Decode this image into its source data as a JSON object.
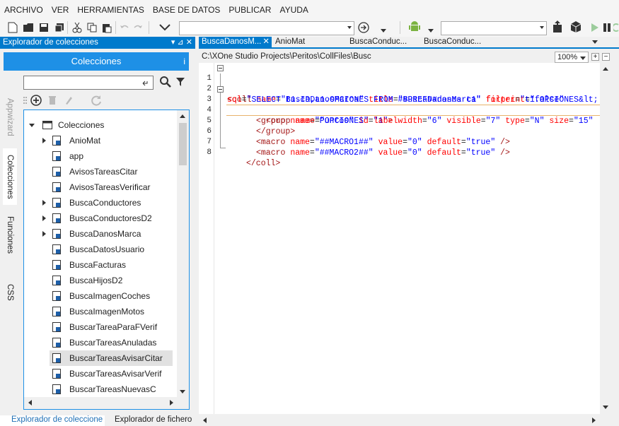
{
  "menu": [
    "ARCHIVO",
    "VER",
    "HERRAMIENTAS",
    "BASE DE DATOS",
    "PUBLICAR",
    "AYUDA"
  ],
  "left_panel": {
    "title": "Explorador de colecciones",
    "controls": "▾ ⊿ ✕",
    "header": "Colecciones",
    "header_info": "i",
    "side_tabs": [
      "Appwizard",
      "Colecciones",
      "Funciones",
      "CSS"
    ],
    "tree": {
      "root": "Colecciones",
      "items": [
        {
          "label": "AnioMat",
          "expandable": true
        },
        {
          "label": "app",
          "expandable": false
        },
        {
          "label": "AvisosTareasCitar",
          "expandable": false
        },
        {
          "label": "AvisosTareasVerificar",
          "expandable": false
        },
        {
          "label": "BuscaConductores",
          "expandable": true
        },
        {
          "label": "BuscaConductoresD2",
          "expandable": true
        },
        {
          "label": "BuscaDanosMarca",
          "expandable": true
        },
        {
          "label": "BuscaDatosUsuario",
          "expandable": false
        },
        {
          "label": "BuscaFacturas",
          "expandable": false
        },
        {
          "label": "BuscaHijosD2",
          "expandable": false
        },
        {
          "label": "BuscaImagenCoches",
          "expandable": false
        },
        {
          "label": "BuscaImagenMotos",
          "expandable": false
        },
        {
          "label": "BuscarTareaParaFVerif",
          "expandable": false
        },
        {
          "label": "BuscarTareasAnuladas",
          "expandable": false
        },
        {
          "label": "BuscarTareasAvisarCitar",
          "expandable": false,
          "selected": true
        },
        {
          "label": "BuscarTareasAvisarVerif",
          "expandable": false
        },
        {
          "label": "BuscarTareasNuevasC",
          "expandable": false
        }
      ]
    },
    "bottom_tabs": [
      "Explorador de coleccione",
      "Explorador de fichero"
    ]
  },
  "editor": {
    "tabs": [
      {
        "label": "BuscaDanosM...",
        "active": true,
        "close": "✕"
      },
      {
        "label": "AnioMat",
        "active": false
      },
      {
        "label": "BuscaConduc...",
        "active": false
      },
      {
        "label": "BuscaConduc...",
        "active": false
      }
    ],
    "path": "C:\\XOne Studio Projects\\Peritos\\CollFiles\\Busc",
    "zoom": "100%",
    "line_numbers": [
      "1",
      "2",
      "3",
      "4",
      "5",
      "6",
      "7",
      "8"
    ],
    "lines": [
      "<coll name=\"BuscaDanosMarca\" title=\"BuscaDanosMarca\" forprint=\"false\"",
      "sql=\"SELECT t1.ID,t1.OPCIONES FROM ##PREF##danos t1\" filter=\"t1.OPCIONES&lt;",
      "<group name=\"Puntos\" id=\"1\">",
      "<prop name=\"OPCIONES\" labelwidth=\"6\" visible=\"7\" type=\"N\" size=\"15\"",
      "</group>",
      "<macro name=\"##MACRO1##\" value=\"0\" default=\"true\" />",
      "<macro name=\"##MACRO2##\" value=\"0\" default=\"true\" />",
      "</coll>"
    ]
  },
  "colors": {
    "accent": "#007acc",
    "header_blue": "#1e90e6",
    "tag": "#a31515",
    "attr": "#ff0000",
    "value": "#0000ff"
  }
}
